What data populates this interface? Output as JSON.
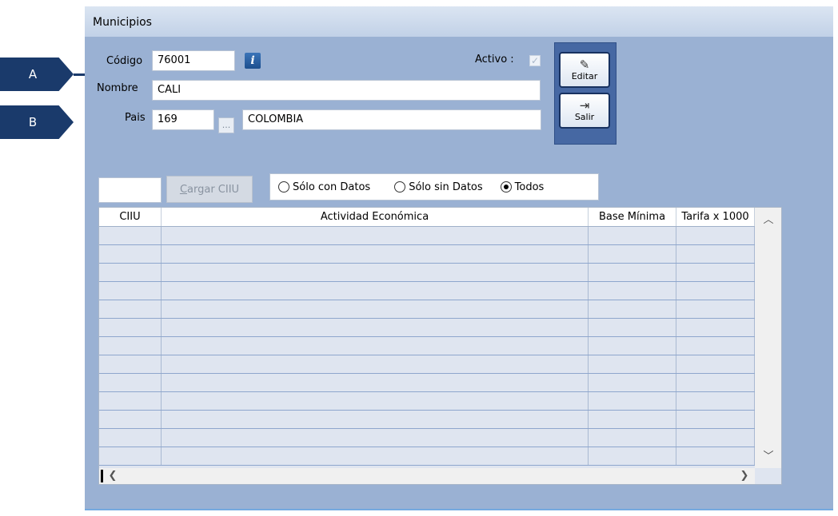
{
  "callouts": {
    "a": "A",
    "b": "B"
  },
  "window": {
    "title": "Municipios"
  },
  "form": {
    "codigo_label": "Código",
    "codigo_value": "76001",
    "info_icon": "i",
    "nombre_label": "Nombre",
    "nombre_value": "CALI",
    "pais_label": "Pais",
    "pais_code": "169",
    "pais_lookup": "...",
    "pais_name": "COLOMBIA",
    "activo_label": "Activo :",
    "activo_checked": true
  },
  "toolbar": {
    "editar_label": "Editar",
    "salir_label": "Salir"
  },
  "filter": {
    "search_value": "",
    "cargar_prefix": "C",
    "cargar_rest": "argar CIIU",
    "options": [
      "Sólo con Datos",
      "Sólo sin Datos",
      "Todos"
    ],
    "selected": "Todos"
  },
  "grid": {
    "columns": [
      "CIIU",
      "Actividad Económica",
      "Base Mínima",
      "Tarifa x 1000"
    ],
    "rows": []
  },
  "colors": {
    "accent": "#1a3a6b",
    "window_bg": "#9ab1d3",
    "grid_bg": "#dfe5f0"
  }
}
